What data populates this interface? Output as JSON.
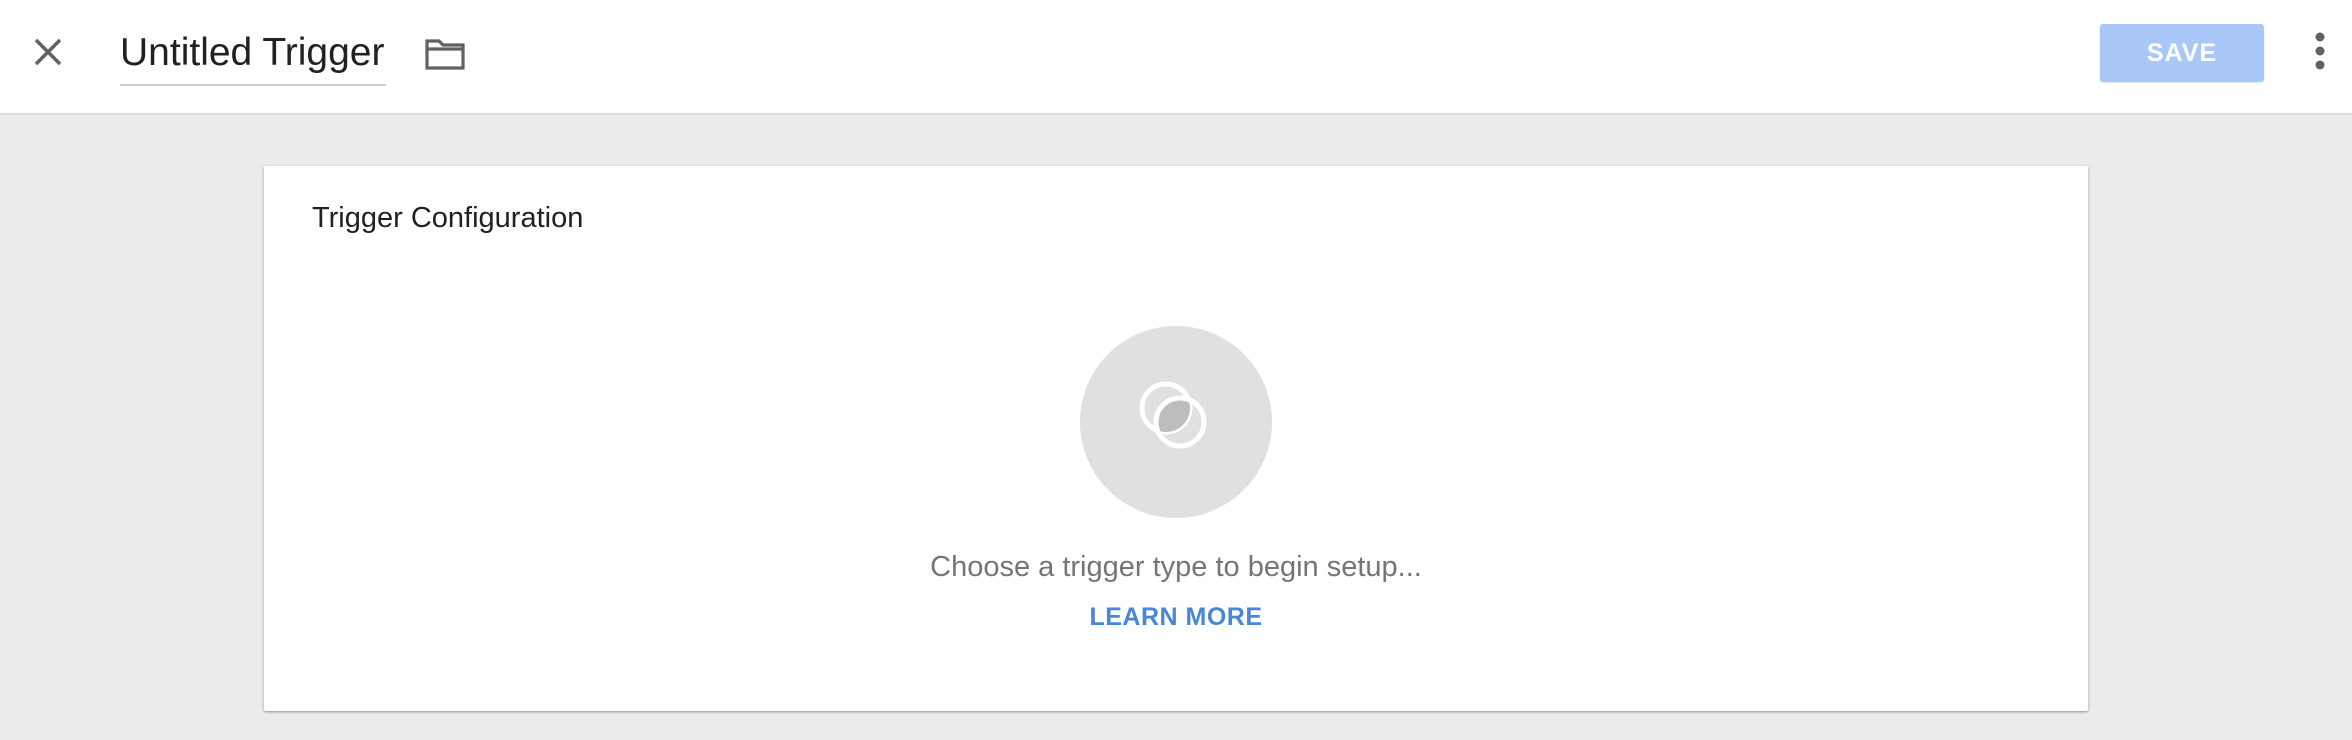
{
  "header": {
    "title": "Untitled Trigger",
    "save_label": "SAVE",
    "icons": {
      "close": "close-icon",
      "folder": "folder-icon",
      "more": "more-vert-icon"
    }
  },
  "trigger_config": {
    "heading": "Trigger Configuration",
    "type_icon": "trigger-type-icon",
    "prompt": "Choose a trigger type to begin setup...",
    "learn_more_label": "LEARN MORE"
  },
  "colors": {
    "page_background": "#ececec",
    "save_button_disabled": "#a9c8f7",
    "link_accent": "#4a86d8",
    "placeholder_circle": "#e0e0e0"
  }
}
